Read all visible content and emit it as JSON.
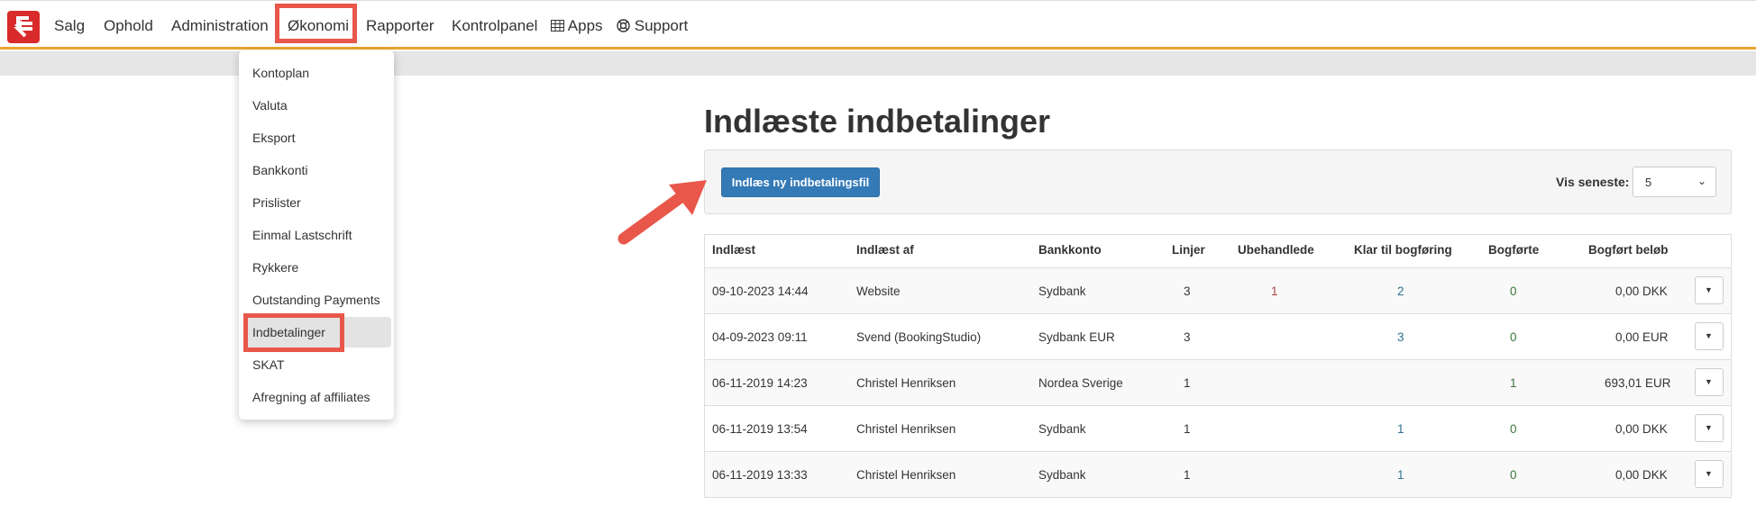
{
  "nav": {
    "items": [
      "Salg",
      "Ophold",
      "Administration",
      "Økonomi",
      "Rapporter",
      "Kontrolpanel",
      "Apps",
      "Support"
    ],
    "active": "Økonomi",
    "icons": {
      "apps": "grid-icon",
      "support": "lifebuoy-icon"
    }
  },
  "dropdown": {
    "items": [
      "Kontoplan",
      "Valuta",
      "Eksport",
      "Bankkonti",
      "Prislister",
      "Einmal Lastschrift",
      "Rykkere",
      "Outstanding Payments",
      "Indbetalinger",
      "SKAT",
      "Afregning af affiliates"
    ],
    "selected": "Indbetalinger"
  },
  "page": {
    "title": "Indlæste indbetalinger",
    "upload_button": "Indlæs ny indbetalingsfil",
    "vis_label": "Vis seneste:",
    "vis_value": "5"
  },
  "table": {
    "headers": [
      "Indlæst",
      "Indlæst af",
      "Bankkonto",
      "Linjer",
      "Ubehandlede",
      "Klar til bogføring",
      "Bogførte",
      "Bogført beløb"
    ],
    "rows": [
      {
        "date": "09-10-2023 14:44",
        "by": "Website",
        "bank": "Sydbank",
        "lines": "3",
        "unprocessed": "1",
        "ready": "2",
        "booked": "0",
        "amount": "0,00 DKK"
      },
      {
        "date": "04-09-2023 09:11",
        "by": "Svend (BookingStudio)",
        "bank": "Sydbank EUR",
        "lines": "3",
        "unprocessed": "",
        "ready": "3",
        "booked": "0",
        "amount": "0,00 EUR"
      },
      {
        "date": "06-11-2019 14:23",
        "by": "Christel Henriksen",
        "bank": "Nordea Sverige",
        "lines": "1",
        "unprocessed": "",
        "ready": "",
        "booked": "1",
        "amount": "693,01 EUR"
      },
      {
        "date": "06-11-2019 13:54",
        "by": "Christel Henriksen",
        "bank": "Sydbank",
        "lines": "1",
        "unprocessed": "",
        "ready": "1",
        "booked": "0",
        "amount": "0,00 DKK"
      },
      {
        "date": "06-11-2019 13:33",
        "by": "Christel Henriksen",
        "bank": "Sydbank",
        "lines": "1",
        "unprocessed": "",
        "ready": "1",
        "booked": "0",
        "amount": "0,00 DKK"
      }
    ]
  },
  "colors": {
    "accent": "#e9a52b",
    "primary": "#337ab7",
    "highlight": "#e8574a",
    "logo": "#d92b2b"
  }
}
